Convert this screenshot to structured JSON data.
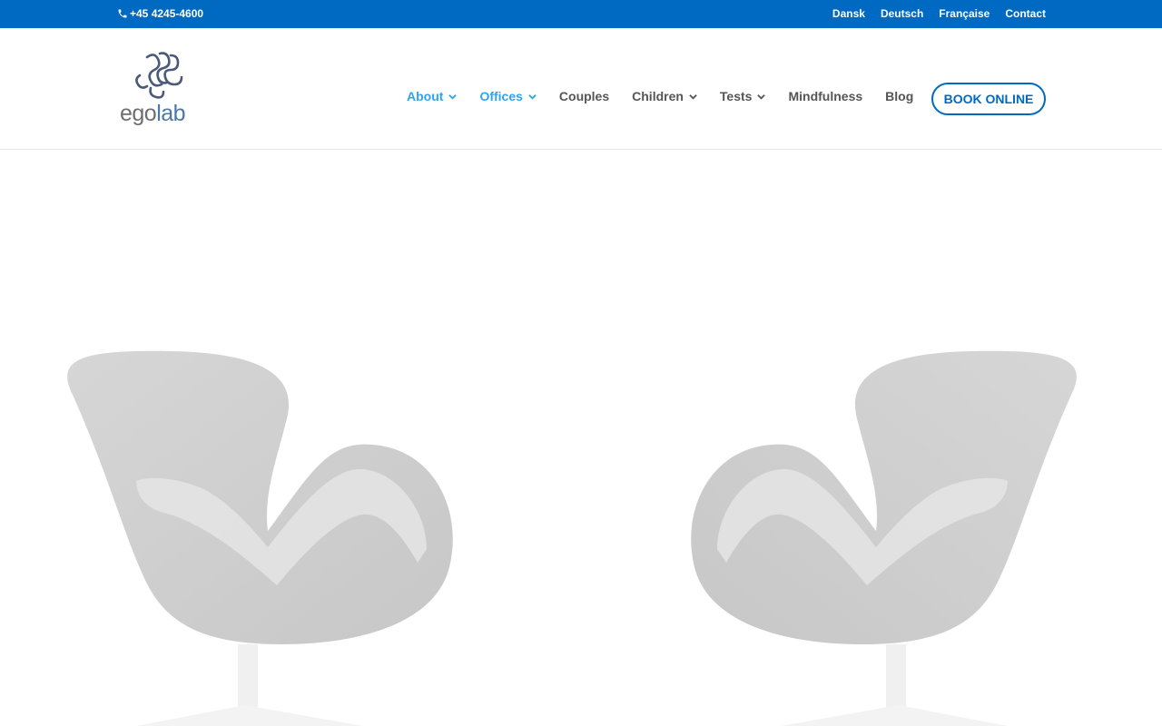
{
  "topbar": {
    "phone": "+45 4245-4600",
    "links": [
      "Dansk",
      "Deutsch",
      "Française",
      "Contact"
    ],
    "color": "#0069c2"
  },
  "logo": {
    "part1": "ego",
    "part2": "lab"
  },
  "nav": {
    "items": [
      {
        "label": "About",
        "dropdown": true,
        "active": true
      },
      {
        "label": "Offices",
        "dropdown": true,
        "active": true
      },
      {
        "label": "Couples",
        "dropdown": false,
        "active": false
      },
      {
        "label": "Children",
        "dropdown": true,
        "active": false
      },
      {
        "label": "Tests",
        "dropdown": true,
        "active": false
      },
      {
        "label": "Mindfulness",
        "dropdown": false,
        "active": false
      },
      {
        "label": "Blog",
        "dropdown": false,
        "active": false
      }
    ],
    "book_button": "BOOK ONLINE",
    "active_color": "#2ea3f2"
  },
  "hero": {
    "image": "two-swan-chairs-facing-each-other"
  }
}
